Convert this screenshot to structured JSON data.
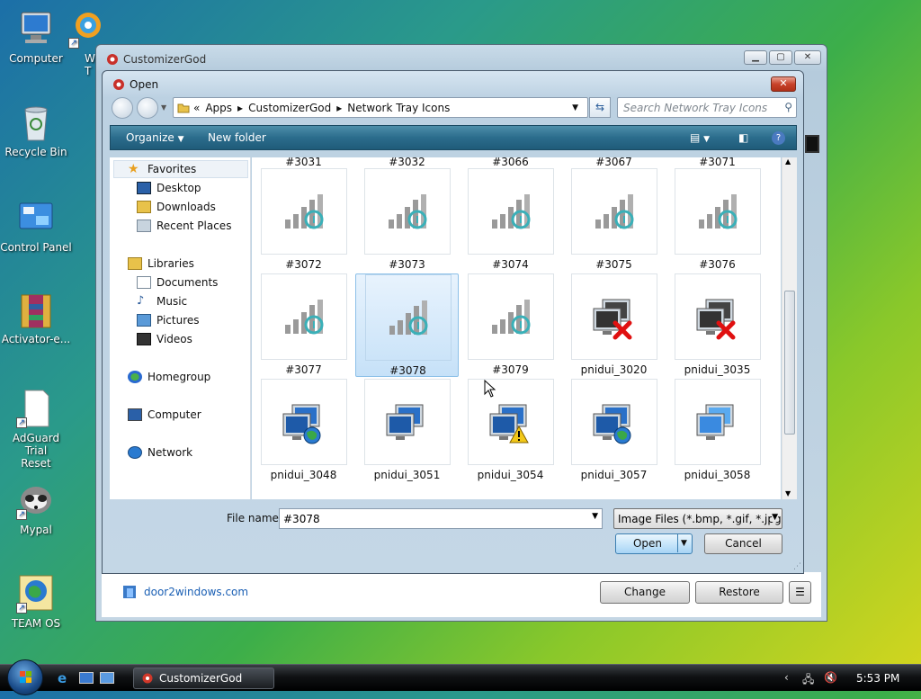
{
  "desktop": {
    "icons": [
      {
        "label": "Computer"
      },
      {
        "label": "Recycle Bin"
      },
      {
        "label": "Control Panel"
      },
      {
        "label": "Activator-e..."
      },
      {
        "label": "AdGuard Trial\nReset"
      },
      {
        "label": "Mypal"
      },
      {
        "label": "TEAM OS"
      },
      {
        "label": "W\nT"
      }
    ]
  },
  "parent_window": {
    "title": "CustomizerGod",
    "footer_link": "door2windows.com",
    "change_label": "Change",
    "restore_label": "Restore",
    "menu_glyph": "☰"
  },
  "dialog": {
    "title": "Open",
    "breadcrumb": [
      "«",
      "Apps",
      "CustomizerGod",
      "Network Tray Icons"
    ],
    "search_placeholder": "Search Network Tray Icons",
    "toolbar": {
      "organize": "Organize",
      "new_folder": "New folder"
    },
    "nav": {
      "favorites": "Favorites",
      "desktop": "Desktop",
      "downloads": "Downloads",
      "recent": "Recent Places",
      "libraries": "Libraries",
      "documents": "Documents",
      "music": "Music",
      "pictures": "Pictures",
      "videos": "Videos",
      "homegroup": "Homegroup",
      "computer": "Computer",
      "network": "Network"
    },
    "files": [
      [
        "#3031",
        "#3032",
        "#3066",
        "#3067",
        "#3071"
      ],
      [
        "#3072",
        "#3073",
        "#3074",
        "#3075",
        "#3076"
      ],
      [
        "#3077",
        "#3078",
        "#3079",
        "pnidui_3020",
        "pnidui_3035"
      ],
      [
        "pnidui_3048",
        "pnidui_3051",
        "pnidui_3054",
        "pnidui_3057",
        "pnidui_3058"
      ]
    ],
    "selected_file": "#3078",
    "file_name_label": "File name:",
    "file_name_value": "#3078",
    "file_type": "Image Files (*.bmp, *.gif, *.jpg,",
    "open_label": "Open",
    "cancel_label": "Cancel"
  },
  "taskbar": {
    "task_label": "CustomizerGod",
    "clock": "5:53 PM"
  },
  "colors": {
    "toolbar": "#2b6c8c",
    "selection": "#c6e1f8",
    "link": "#1a5fb4"
  }
}
